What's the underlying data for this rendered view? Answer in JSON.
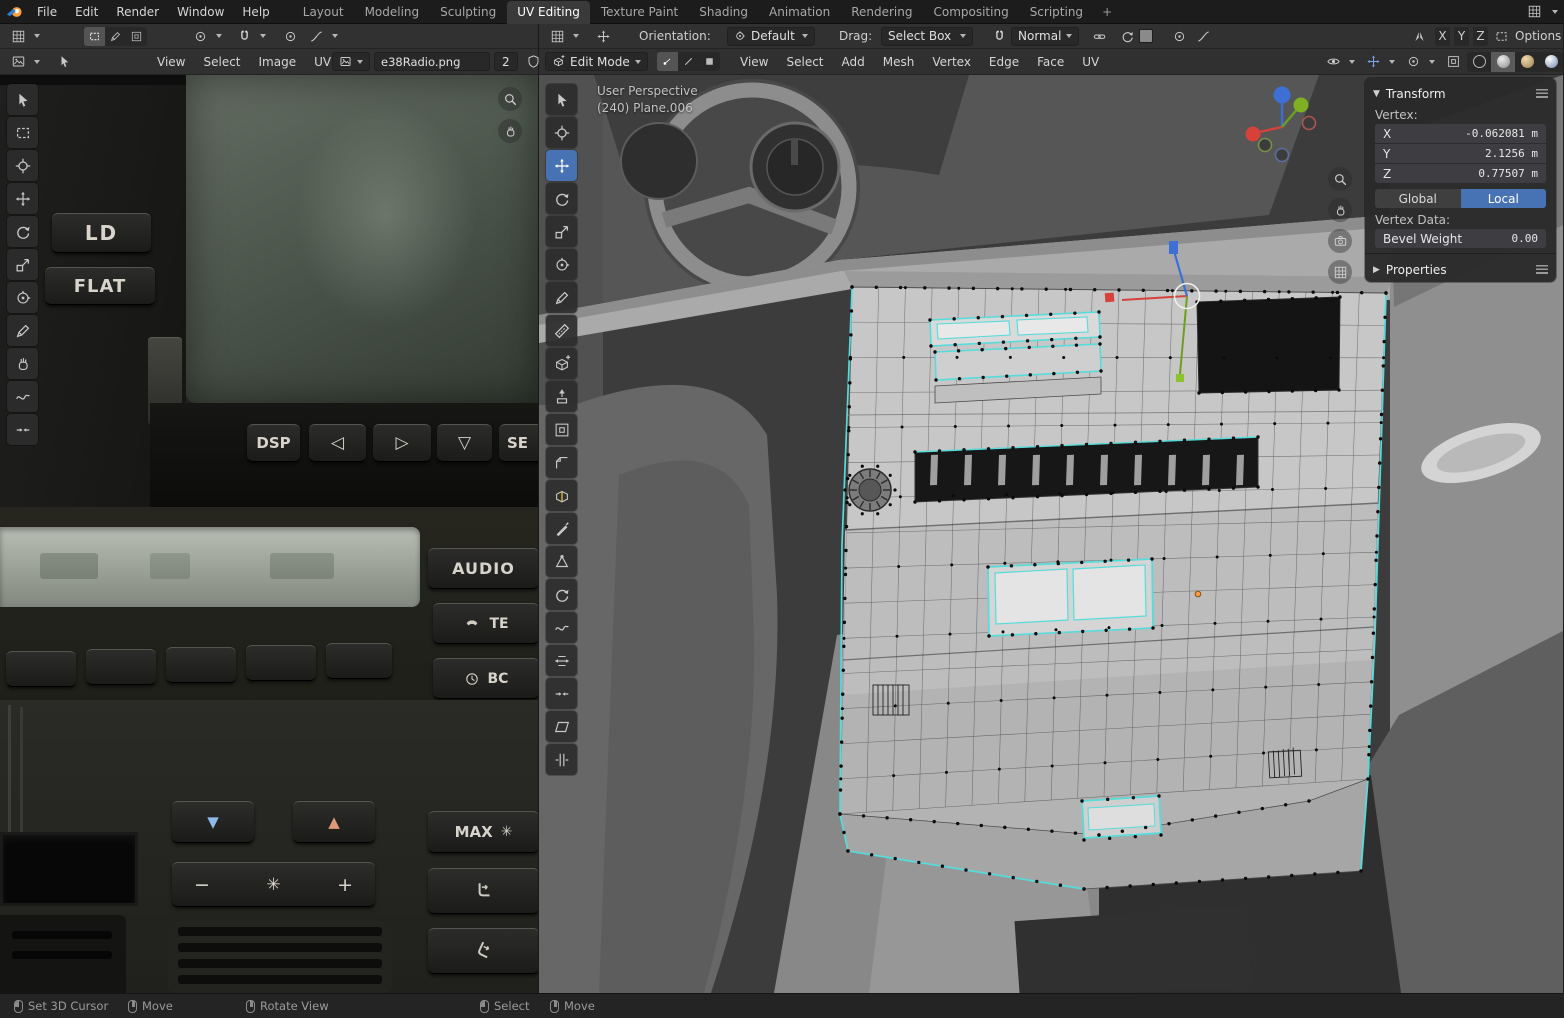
{
  "topbar": {
    "menus": [
      "File",
      "Edit",
      "Render",
      "Window",
      "Help"
    ],
    "tabs": [
      "Layout",
      "Modeling",
      "Sculpting",
      "UV Editing",
      "Texture Paint",
      "Shading",
      "Animation",
      "Rendering",
      "Compositing",
      "Scripting"
    ],
    "active_tab": "UV Editing",
    "add_tab": "+"
  },
  "uv_editor": {
    "menus": [
      "View",
      "Select",
      "Image",
      "UV"
    ],
    "image_name": "e38Radio.png",
    "users_count": "2",
    "radio": {
      "ld": "LD",
      "flat": "FLAT",
      "dsp": "DSP",
      "se": "SE",
      "audio": "AUDIO",
      "tel": "TE",
      "bc": "BC",
      "max": "MAX",
      "left_arrow": "◁",
      "right_arrow": "▷",
      "down_arrow": "▽",
      "temp_down": "▼",
      "temp_up": "▲",
      "minus": "−",
      "plus": "+",
      "fan": "✳"
    }
  },
  "viewport": {
    "tool_settings": {
      "orientation_label": "Orientation:",
      "orientation_value": "Default",
      "drag_label": "Drag:",
      "drag_value": "Select Box",
      "snap_value": "Normal",
      "mirror_axes": [
        "X",
        "Y",
        "Z"
      ],
      "options_label": "Options"
    },
    "header": {
      "mode": "Edit Mode",
      "menus": [
        "View",
        "Select",
        "Add",
        "Mesh",
        "Vertex",
        "Edge",
        "Face",
        "UV"
      ]
    },
    "overlay": {
      "line1": "User Perspective",
      "line2": "(240) Plane.006"
    }
  },
  "sidebar": {
    "transform": {
      "title": "Transform",
      "vertex_label": "Vertex:",
      "rows": [
        {
          "axis": "X",
          "value": "-0.062081 m"
        },
        {
          "axis": "Y",
          "value": "2.1256 m"
        },
        {
          "axis": "Z",
          "value": "0.77507 m"
        }
      ],
      "global_label": "Global",
      "local_label": "Local",
      "vertex_data_label": "Vertex Data:",
      "bevel_label": "Bevel Weight",
      "bevel_value": "0.00"
    },
    "properties_title": "Properties"
  },
  "statusbar": {
    "hints": [
      "Set 3D Cursor",
      "Move",
      "Rotate View",
      "Select",
      "Move"
    ]
  },
  "icons": {
    "panel_open": "▼",
    "panel_closed": "▶"
  },
  "colors": {
    "accent": "#4772b3",
    "selection": "#57dbdb",
    "axis_x": "#d6413c",
    "axis_y": "#6f9f1f",
    "axis_z": "#3d6fd4"
  }
}
